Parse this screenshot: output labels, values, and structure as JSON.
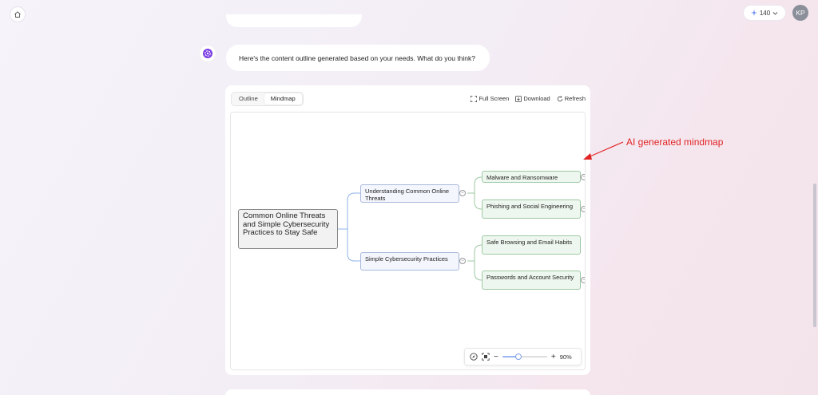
{
  "header": {
    "credits": "140",
    "avatar_initials": "KP"
  },
  "chat": {
    "message": "Here's the content outline generated based on your needs. What do you think?"
  },
  "outline_card": {
    "tabs": [
      {
        "label": "Outline",
        "active": false
      },
      {
        "label": "Mindmap",
        "active": true
      }
    ],
    "actions": {
      "full_screen": "Full Screen",
      "download": "Download",
      "refresh": "Refresh"
    },
    "mindmap": {
      "root": "Common Online Threats and Simple Cybersecurity Practices to Stay Safe",
      "branches": [
        {
          "label": "Understanding Common Online Threats",
          "children": [
            "Malware and Ransomware",
            "Phishing and Social Engineering"
          ]
        },
        {
          "label": "Simple Cybersecurity Practices",
          "children": [
            "Safe Browsing and Email Habits",
            "Passwords and Account Security"
          ]
        }
      ]
    },
    "zoom": {
      "percent_label": "90%",
      "level": 0.9
    }
  },
  "annotation": {
    "text": "AI generated mindmap",
    "color": "#e02424"
  },
  "colors": {
    "l1_border": "#a9b8dd",
    "l2_border": "#9dc8a3",
    "accent": "#7b3fe4"
  }
}
